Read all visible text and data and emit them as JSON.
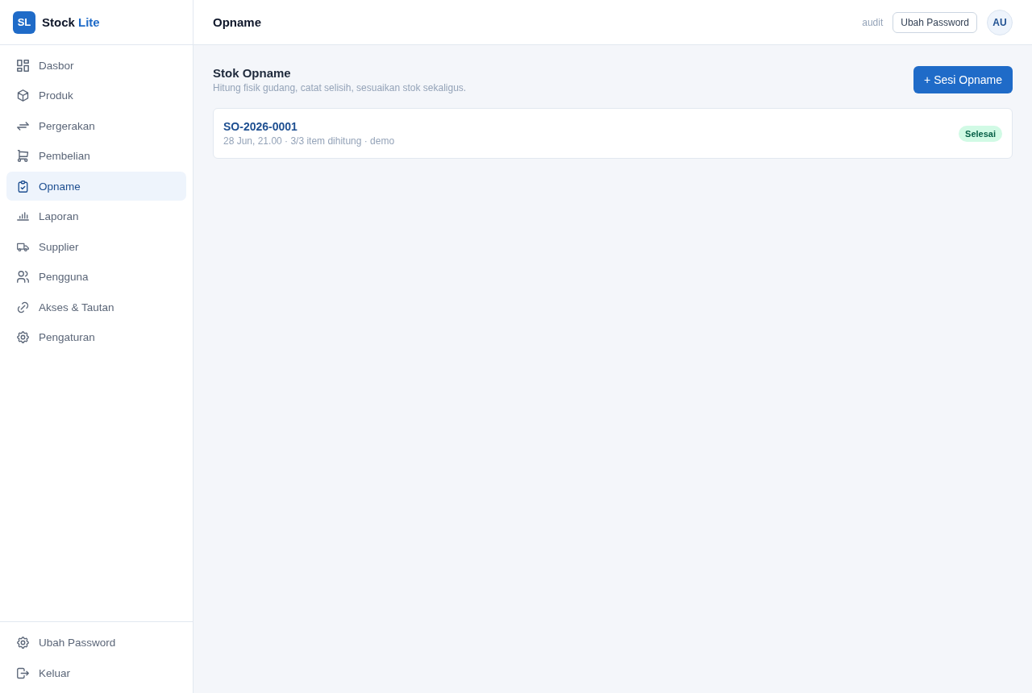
{
  "app": {
    "logo": "SL",
    "name": "Stock",
    "name_accent": "Lite"
  },
  "sidebar": {
    "items": [
      {
        "label": "Dasbor",
        "selected": false
      },
      {
        "label": "Produk",
        "selected": false
      },
      {
        "label": "Pergerakan",
        "selected": false
      },
      {
        "label": "Pembelian",
        "selected": false
      },
      {
        "label": "Opname",
        "selected": true
      },
      {
        "label": "Laporan",
        "selected": false
      },
      {
        "label": "Supplier",
        "selected": false
      },
      {
        "label": "Pengguna",
        "selected": false
      },
      {
        "label": "Akses & Tautan",
        "selected": false
      },
      {
        "label": "Pengaturan",
        "selected": false
      }
    ],
    "footer_items": [
      {
        "label": "Ubah Password"
      },
      {
        "label": "Keluar"
      }
    ]
  },
  "header": {
    "title": "Opname",
    "user_role": "audit",
    "change_password_button": "Ubah Password",
    "avatar": "AU"
  },
  "page": {
    "title": "Stok Opname",
    "subtitle": "Hitung fisik gudang, catat selisih, sesuaikan stok sekaligus.",
    "new_button": "+ Sesi Opname",
    "sessions": [
      {
        "code": "SO-2026-0001",
        "meta": "28 Jun, 21.00 · 3/3 item dihitung · demo",
        "status": "Selesai"
      }
    ]
  }
}
